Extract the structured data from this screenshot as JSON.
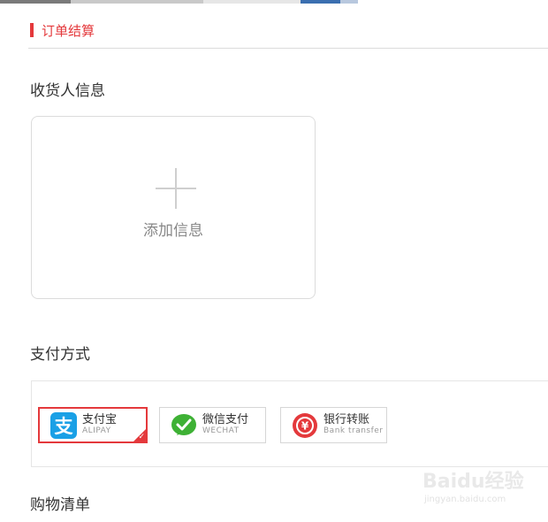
{
  "header": {
    "title": "订单结算"
  },
  "sections": {
    "receiver_title": "收货人信息",
    "payment_title": "支付方式",
    "cart_title": "购物清单"
  },
  "address_card": {
    "add_label": "添加信息",
    "icon": "plus-icon"
  },
  "payment_options": [
    {
      "name": "支付宝",
      "sub": "ALIPAY",
      "icon": "alipay-icon",
      "selected": true,
      "color": "#1aa0e6"
    },
    {
      "name": "微信支付",
      "sub": "WECHAT",
      "icon": "wechat-icon",
      "selected": false,
      "color": "#3eb135"
    },
    {
      "name": "银行转账",
      "sub": "Bank transfer",
      "icon": "bank-transfer-icon",
      "selected": false,
      "color": "#e4393c"
    }
  ],
  "watermark": {
    "main": "Baidu经验",
    "sub": "jingyan.baidu.com"
  },
  "colors": {
    "accent": "#e4393c",
    "border": "#dcdcdc"
  }
}
